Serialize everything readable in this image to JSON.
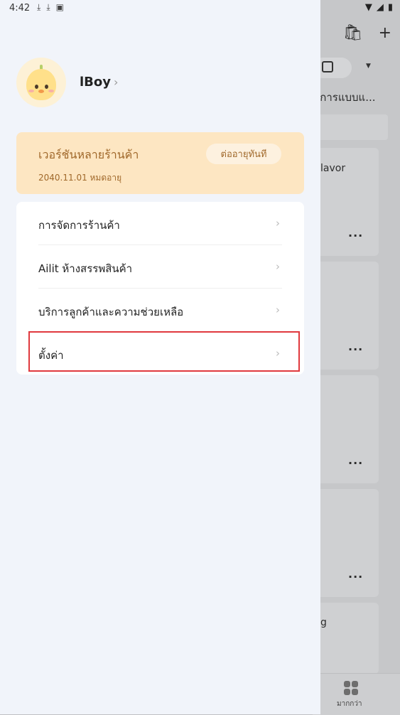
{
  "status_bar": {
    "time": "4:42",
    "left_icons": [
      "download-icon",
      "download-icon",
      "a-icon"
    ],
    "right_icons": [
      "wifi-icon",
      "signal-icon",
      "battery-icon"
    ]
  },
  "profile": {
    "username": "lBoy",
    "chevron": "›"
  },
  "vip": {
    "title": "เวอร์ชันหลายร้านค้า",
    "expiry": "2040.11.01 หมดอายุ",
    "renew_label": "ต่ออายุทันที"
  },
  "menu": {
    "items": [
      {
        "label": "การจัดการร้านค้า"
      },
      {
        "label": "Ailit ห้างสรรพสินค้า"
      },
      {
        "label": "บริการลูกค้าและความช่วยเหลือ"
      },
      {
        "label": "ตั้งค่า"
      }
    ],
    "chevron": "›"
  },
  "background": {
    "tab_text": "นการแบบแ...",
    "card_title_1": "lavor",
    "card_title_5": "g",
    "more": "...",
    "bottom_nav_label": "มากกว่า"
  },
  "colors": {
    "drawer_bg": "#f1f4fa",
    "vip_bg": "#fde6c2",
    "vip_text": "#a0682a",
    "highlight": "#e0393e"
  }
}
